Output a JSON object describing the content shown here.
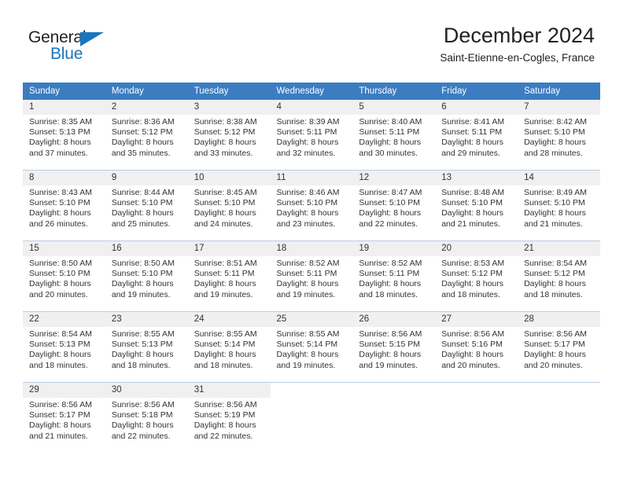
{
  "brand": {
    "name_top": "General",
    "name_bottom": "Blue",
    "accent_color": "#1b75bb"
  },
  "header": {
    "title": "December 2024",
    "subtitle": "Saint-Etienne-en-Cogles, France"
  },
  "calendar": {
    "header_color": "#3b7dc0",
    "daynum_band_color": "#f0f0f0",
    "weekday_headers": [
      "Sunday",
      "Monday",
      "Tuesday",
      "Wednesday",
      "Thursday",
      "Friday",
      "Saturday"
    ],
    "weeks": [
      [
        {
          "day": "1",
          "sunrise": "Sunrise: 8:35 AM",
          "sunset": "Sunset: 5:13 PM",
          "daylight_line1": "Daylight: 8 hours",
          "daylight_line2": "and 37 minutes."
        },
        {
          "day": "2",
          "sunrise": "Sunrise: 8:36 AM",
          "sunset": "Sunset: 5:12 PM",
          "daylight_line1": "Daylight: 8 hours",
          "daylight_line2": "and 35 minutes."
        },
        {
          "day": "3",
          "sunrise": "Sunrise: 8:38 AM",
          "sunset": "Sunset: 5:12 PM",
          "daylight_line1": "Daylight: 8 hours",
          "daylight_line2": "and 33 minutes."
        },
        {
          "day": "4",
          "sunrise": "Sunrise: 8:39 AM",
          "sunset": "Sunset: 5:11 PM",
          "daylight_line1": "Daylight: 8 hours",
          "daylight_line2": "and 32 minutes."
        },
        {
          "day": "5",
          "sunrise": "Sunrise: 8:40 AM",
          "sunset": "Sunset: 5:11 PM",
          "daylight_line1": "Daylight: 8 hours",
          "daylight_line2": "and 30 minutes."
        },
        {
          "day": "6",
          "sunrise": "Sunrise: 8:41 AM",
          "sunset": "Sunset: 5:11 PM",
          "daylight_line1": "Daylight: 8 hours",
          "daylight_line2": "and 29 minutes."
        },
        {
          "day": "7",
          "sunrise": "Sunrise: 8:42 AM",
          "sunset": "Sunset: 5:10 PM",
          "daylight_line1": "Daylight: 8 hours",
          "daylight_line2": "and 28 minutes."
        }
      ],
      [
        {
          "day": "8",
          "sunrise": "Sunrise: 8:43 AM",
          "sunset": "Sunset: 5:10 PM",
          "daylight_line1": "Daylight: 8 hours",
          "daylight_line2": "and 26 minutes."
        },
        {
          "day": "9",
          "sunrise": "Sunrise: 8:44 AM",
          "sunset": "Sunset: 5:10 PM",
          "daylight_line1": "Daylight: 8 hours",
          "daylight_line2": "and 25 minutes."
        },
        {
          "day": "10",
          "sunrise": "Sunrise: 8:45 AM",
          "sunset": "Sunset: 5:10 PM",
          "daylight_line1": "Daylight: 8 hours",
          "daylight_line2": "and 24 minutes."
        },
        {
          "day": "11",
          "sunrise": "Sunrise: 8:46 AM",
          "sunset": "Sunset: 5:10 PM",
          "daylight_line1": "Daylight: 8 hours",
          "daylight_line2": "and 23 minutes."
        },
        {
          "day": "12",
          "sunrise": "Sunrise: 8:47 AM",
          "sunset": "Sunset: 5:10 PM",
          "daylight_line1": "Daylight: 8 hours",
          "daylight_line2": "and 22 minutes."
        },
        {
          "day": "13",
          "sunrise": "Sunrise: 8:48 AM",
          "sunset": "Sunset: 5:10 PM",
          "daylight_line1": "Daylight: 8 hours",
          "daylight_line2": "and 21 minutes."
        },
        {
          "day": "14",
          "sunrise": "Sunrise: 8:49 AM",
          "sunset": "Sunset: 5:10 PM",
          "daylight_line1": "Daylight: 8 hours",
          "daylight_line2": "and 21 minutes."
        }
      ],
      [
        {
          "day": "15",
          "sunrise": "Sunrise: 8:50 AM",
          "sunset": "Sunset: 5:10 PM",
          "daylight_line1": "Daylight: 8 hours",
          "daylight_line2": "and 20 minutes."
        },
        {
          "day": "16",
          "sunrise": "Sunrise: 8:50 AM",
          "sunset": "Sunset: 5:10 PM",
          "daylight_line1": "Daylight: 8 hours",
          "daylight_line2": "and 19 minutes."
        },
        {
          "day": "17",
          "sunrise": "Sunrise: 8:51 AM",
          "sunset": "Sunset: 5:11 PM",
          "daylight_line1": "Daylight: 8 hours",
          "daylight_line2": "and 19 minutes."
        },
        {
          "day": "18",
          "sunrise": "Sunrise: 8:52 AM",
          "sunset": "Sunset: 5:11 PM",
          "daylight_line1": "Daylight: 8 hours",
          "daylight_line2": "and 19 minutes."
        },
        {
          "day": "19",
          "sunrise": "Sunrise: 8:52 AM",
          "sunset": "Sunset: 5:11 PM",
          "daylight_line1": "Daylight: 8 hours",
          "daylight_line2": "and 18 minutes."
        },
        {
          "day": "20",
          "sunrise": "Sunrise: 8:53 AM",
          "sunset": "Sunset: 5:12 PM",
          "daylight_line1": "Daylight: 8 hours",
          "daylight_line2": "and 18 minutes."
        },
        {
          "day": "21",
          "sunrise": "Sunrise: 8:54 AM",
          "sunset": "Sunset: 5:12 PM",
          "daylight_line1": "Daylight: 8 hours",
          "daylight_line2": "and 18 minutes."
        }
      ],
      [
        {
          "day": "22",
          "sunrise": "Sunrise: 8:54 AM",
          "sunset": "Sunset: 5:13 PM",
          "daylight_line1": "Daylight: 8 hours",
          "daylight_line2": "and 18 minutes."
        },
        {
          "day": "23",
          "sunrise": "Sunrise: 8:55 AM",
          "sunset": "Sunset: 5:13 PM",
          "daylight_line1": "Daylight: 8 hours",
          "daylight_line2": "and 18 minutes."
        },
        {
          "day": "24",
          "sunrise": "Sunrise: 8:55 AM",
          "sunset": "Sunset: 5:14 PM",
          "daylight_line1": "Daylight: 8 hours",
          "daylight_line2": "and 18 minutes."
        },
        {
          "day": "25",
          "sunrise": "Sunrise: 8:55 AM",
          "sunset": "Sunset: 5:14 PM",
          "daylight_line1": "Daylight: 8 hours",
          "daylight_line2": "and 19 minutes."
        },
        {
          "day": "26",
          "sunrise": "Sunrise: 8:56 AM",
          "sunset": "Sunset: 5:15 PM",
          "daylight_line1": "Daylight: 8 hours",
          "daylight_line2": "and 19 minutes."
        },
        {
          "day": "27",
          "sunrise": "Sunrise: 8:56 AM",
          "sunset": "Sunset: 5:16 PM",
          "daylight_line1": "Daylight: 8 hours",
          "daylight_line2": "and 20 minutes."
        },
        {
          "day": "28",
          "sunrise": "Sunrise: 8:56 AM",
          "sunset": "Sunset: 5:17 PM",
          "daylight_line1": "Daylight: 8 hours",
          "daylight_line2": "and 20 minutes."
        }
      ],
      [
        {
          "day": "29",
          "sunrise": "Sunrise: 8:56 AM",
          "sunset": "Sunset: 5:17 PM",
          "daylight_line1": "Daylight: 8 hours",
          "daylight_line2": "and 21 minutes."
        },
        {
          "day": "30",
          "sunrise": "Sunrise: 8:56 AM",
          "sunset": "Sunset: 5:18 PM",
          "daylight_line1": "Daylight: 8 hours",
          "daylight_line2": "and 22 minutes."
        },
        {
          "day": "31",
          "sunrise": "Sunrise: 8:56 AM",
          "sunset": "Sunset: 5:19 PM",
          "daylight_line1": "Daylight: 8 hours",
          "daylight_line2": "and 22 minutes."
        },
        {
          "day": "",
          "sunrise": "",
          "sunset": "",
          "daylight_line1": "",
          "daylight_line2": ""
        },
        {
          "day": "",
          "sunrise": "",
          "sunset": "",
          "daylight_line1": "",
          "daylight_line2": ""
        },
        {
          "day": "",
          "sunrise": "",
          "sunset": "",
          "daylight_line1": "",
          "daylight_line2": ""
        },
        {
          "day": "",
          "sunrise": "",
          "sunset": "",
          "daylight_line1": "",
          "daylight_line2": ""
        }
      ]
    ]
  }
}
